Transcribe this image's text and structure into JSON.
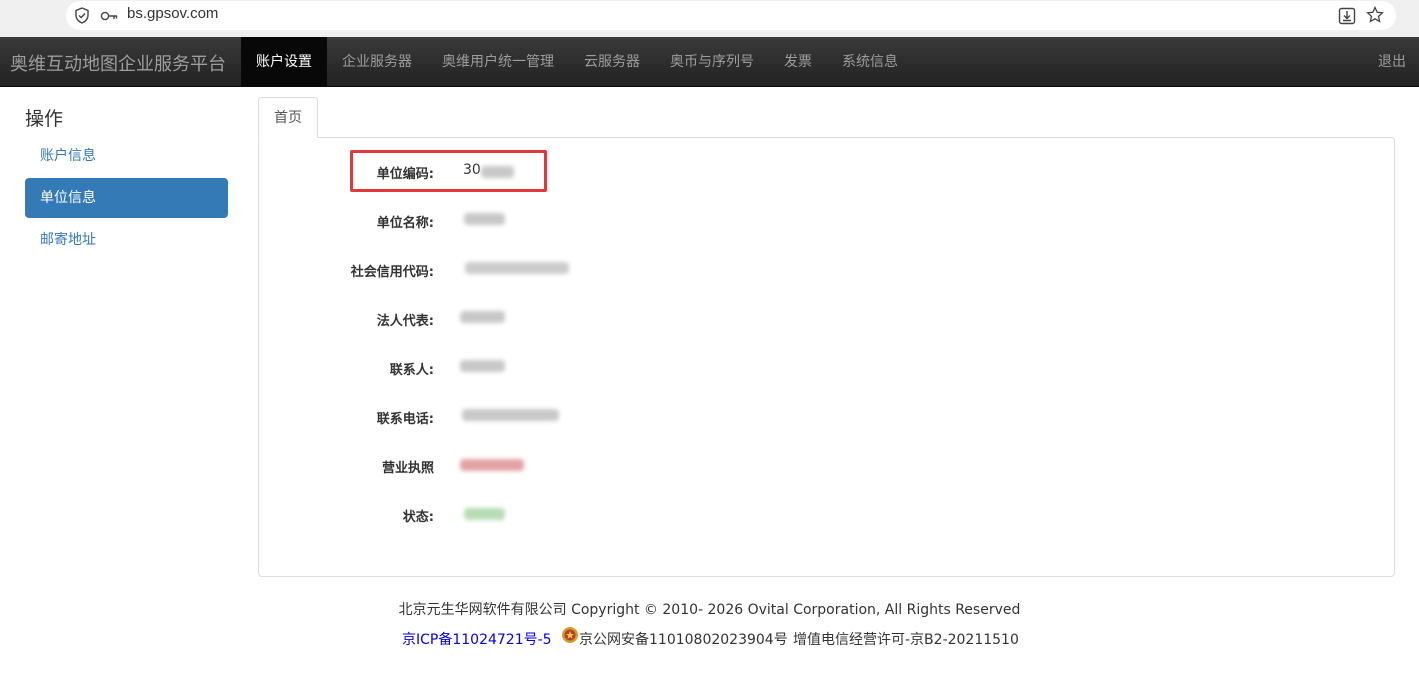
{
  "browser": {
    "url": "bs.gpsov.com"
  },
  "navbar": {
    "brand": "奥维互动地图企业服务平台",
    "items": [
      {
        "label": "账户设置",
        "active": true
      },
      {
        "label": "企业服务器"
      },
      {
        "label": "奥维用户统一管理"
      },
      {
        "label": "云服务器"
      },
      {
        "label": "奥币与序列号"
      },
      {
        "label": "发票"
      },
      {
        "label": "系统信息"
      }
    ],
    "logout": "退出"
  },
  "sidebar": {
    "title": "操作",
    "items": [
      {
        "label": "账户信息"
      },
      {
        "label": "单位信息",
        "active": true
      },
      {
        "label": "邮寄地址"
      }
    ]
  },
  "tabs": [
    {
      "label": "首页",
      "active": true
    }
  ],
  "form": {
    "rows": [
      {
        "label": "单位编码:",
        "value": "30"
      },
      {
        "label": "单位名称:",
        "value": ""
      },
      {
        "label": "社会信用代码:",
        "value": ""
      },
      {
        "label": "法人代表:",
        "value": ""
      },
      {
        "label": "联系人:",
        "value": ""
      },
      {
        "label": "联系电话:",
        "value": ""
      },
      {
        "label": "营业执照",
        "value": ""
      },
      {
        "label": "状态:",
        "value": ""
      }
    ]
  },
  "footer": {
    "copyright": "北京元生华网软件有限公司 Copyright © 2010- 2026 Ovital Corporation, All Rights Reserved",
    "icp": "京ICP备11024721号-5",
    "police": "京公网安备11010802023904号",
    "license": "增值电信经营许可-京B2-20211510"
  },
  "colors": {
    "navbar_bg": "#222222",
    "accent": "#337ab7",
    "highlight": "#e0393d",
    "link": "#0000ee"
  }
}
